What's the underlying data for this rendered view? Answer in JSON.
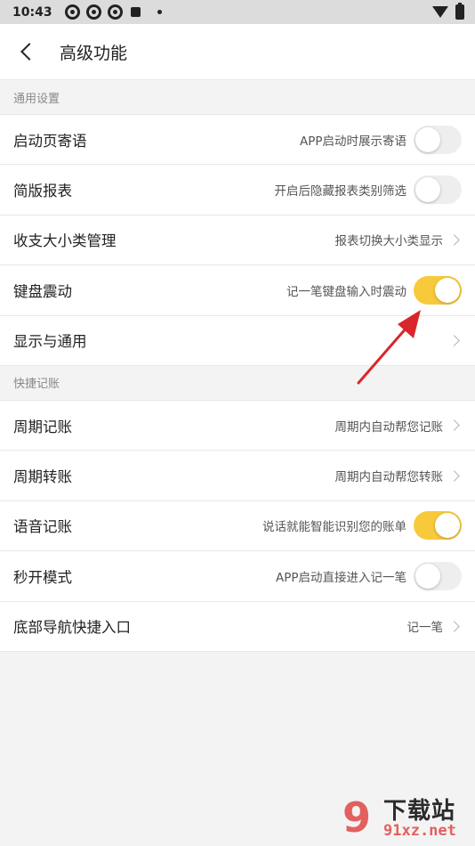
{
  "status_bar": {
    "time": "10:43"
  },
  "header": {
    "title": "高级功能"
  },
  "sections": [
    {
      "label": "通用设置",
      "rows": [
        {
          "title": "启动页寄语",
          "desc": "APP启动时展示寄语",
          "control": "toggle",
          "on": false
        },
        {
          "title": "简版报表",
          "desc": "开启后隐藏报表类别筛选",
          "control": "toggle",
          "on": false
        },
        {
          "title": "收支大小类管理",
          "desc": "报表切换大小类显示",
          "control": "chevron"
        },
        {
          "title": "键盘震动",
          "desc": "记一笔键盘输入时震动",
          "control": "toggle",
          "on": true
        },
        {
          "title": "显示与通用",
          "desc": "",
          "control": "chevron"
        }
      ]
    },
    {
      "label": "快捷记账",
      "rows": [
        {
          "title": "周期记账",
          "desc": "周期内自动帮您记账",
          "control": "chevron"
        },
        {
          "title": "周期转账",
          "desc": "周期内自动帮您转账",
          "control": "chevron"
        },
        {
          "title": "语音记账",
          "desc": "说话就能智能识别您的账单",
          "control": "toggle",
          "on": true
        },
        {
          "title": "秒开模式",
          "desc": "APP启动直接进入记一笔",
          "control": "toggle",
          "on": false
        },
        {
          "title": "底部导航快捷入口",
          "desc": "记一笔",
          "control": "chevron"
        }
      ]
    }
  ],
  "watermark": {
    "logo": "9",
    "title": "下载站",
    "url": "91xz.net"
  },
  "colors": {
    "toggle_on": "#f8c93a",
    "toggle_off": "#eeeeee",
    "annotation_arrow": "#d9262a"
  }
}
